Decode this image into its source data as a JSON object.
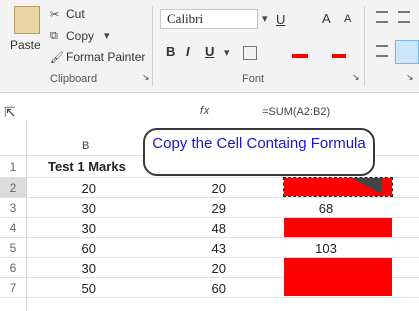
{
  "ribbon": {
    "clipboard": {
      "paste_label": "Paste",
      "cut_label": "Cut",
      "copy_label": "Copy",
      "format_painter_label": "Format Painter",
      "group_label": "Clipboard"
    },
    "font": {
      "font_name": "Calibri",
      "group_label": "Font",
      "bold": "B",
      "italic": "I",
      "underline": "U",
      "grow": "A",
      "shrink": "A"
    }
  },
  "formula_bar": {
    "formula": "=SUM(A2:B2)"
  },
  "sheet": {
    "column_letter": "B",
    "header": "Test 1 Marks",
    "row_numbers": [
      "1",
      "2",
      "3",
      "4",
      "5",
      "6",
      "7"
    ],
    "col_a": [
      "20",
      "30",
      "30",
      "60",
      "30",
      "50"
    ],
    "col_b": [
      "20",
      "29",
      "48",
      "43",
      "20",
      "60"
    ],
    "col_c": [
      "",
      "68",
      "",
      "103",
      "",
      ""
    ]
  },
  "callout": {
    "text": "Copy the Cell Containg Formula"
  },
  "colors": {
    "highlight": "#ff0000",
    "callout_text": "#1717c9"
  }
}
